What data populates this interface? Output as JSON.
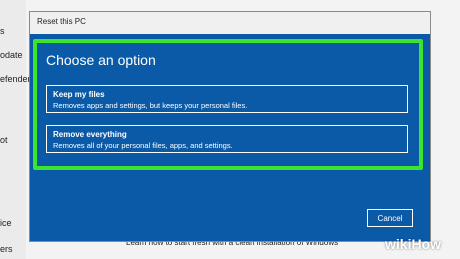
{
  "background": {
    "nav_items": [
      "s",
      "odate",
      "efender",
      "ot",
      "ice",
      "ers"
    ],
    "bottom_link": "Learn how to start fresh with a clean installation of Windows"
  },
  "dialog": {
    "title": "Reset this PC",
    "heading": "Choose an option",
    "options": [
      {
        "title": "Keep my files",
        "description": "Removes apps and settings, but keeps your personal files."
      },
      {
        "title": "Remove everything",
        "description": "Removes all of your personal files, apps, and settings."
      }
    ],
    "cancel_label": "Cancel"
  },
  "watermark": {
    "wiki": "wiki",
    "how": "How"
  },
  "colors": {
    "dialog_bg": "#0b5aa8",
    "highlight": "#39e52e",
    "text_on_blue": "#ffffff"
  }
}
